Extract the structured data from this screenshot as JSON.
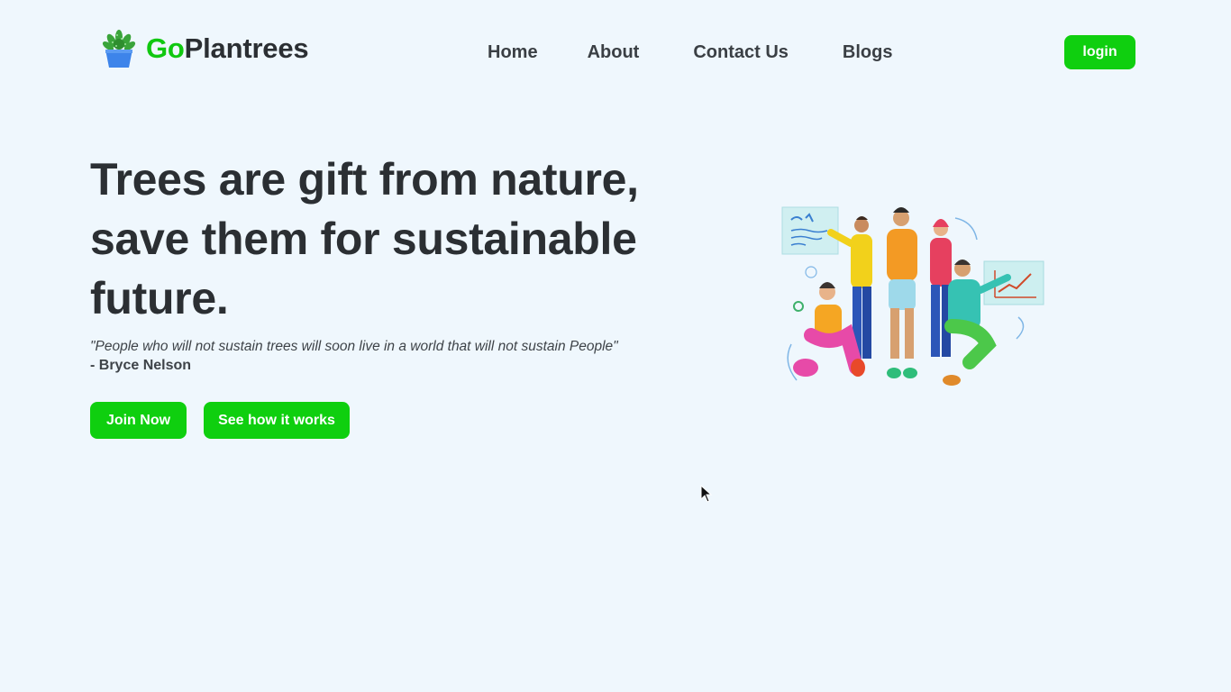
{
  "brand": {
    "prefix": "Go",
    "suffix": "Plantrees",
    "accent_color": "#10c810"
  },
  "nav": {
    "items": [
      {
        "label": "Home"
      },
      {
        "label": "About"
      },
      {
        "label": "Contact Us"
      },
      {
        "label": "Blogs"
      }
    ]
  },
  "header": {
    "login_label": "login"
  },
  "hero": {
    "title": "Trees are gift from nature, save them for sustainable future.",
    "quote": "\"People who will not sustain trees will soon live in a world that will not sustain People\"",
    "author": "- Bryce Nelson",
    "join_label": "Join Now",
    "how_label": "See how it works"
  },
  "icons": {
    "logo": "potted-plant-icon",
    "cursor": "mouse-pointer-icon"
  },
  "colors": {
    "primary_button": "#0fcf0f",
    "background": "#eff7fd",
    "text": "#2b2f33"
  }
}
